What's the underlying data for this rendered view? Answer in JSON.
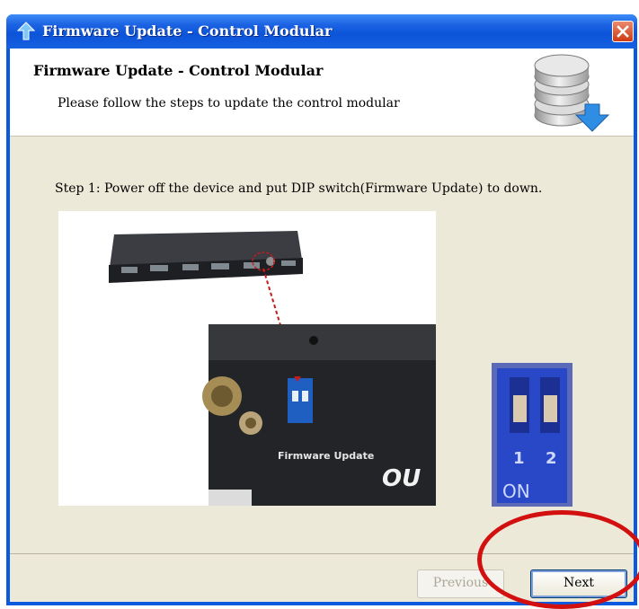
{
  "window": {
    "title": "Firmware Update - Control Modular",
    "close_icon": "close-icon"
  },
  "header": {
    "title": "Firmware Update - Control Modular",
    "subtitle": "Please follow the steps to update the control modular",
    "icon": "database-download-icon"
  },
  "content": {
    "step_text": "Step 1: Power off the device and put DIP switch(Firmware Update) to down.",
    "photo_label": "Firmware Update",
    "photo_text_ou": "OU",
    "dip_labels": {
      "one": "1",
      "two": "2",
      "on": "ON"
    }
  },
  "buttons": {
    "previous": "Previous",
    "next": "Next"
  },
  "colors": {
    "title_bar": "#0c54d8",
    "dialog_bg": "#ece9d8",
    "highlight": "#d21010"
  }
}
